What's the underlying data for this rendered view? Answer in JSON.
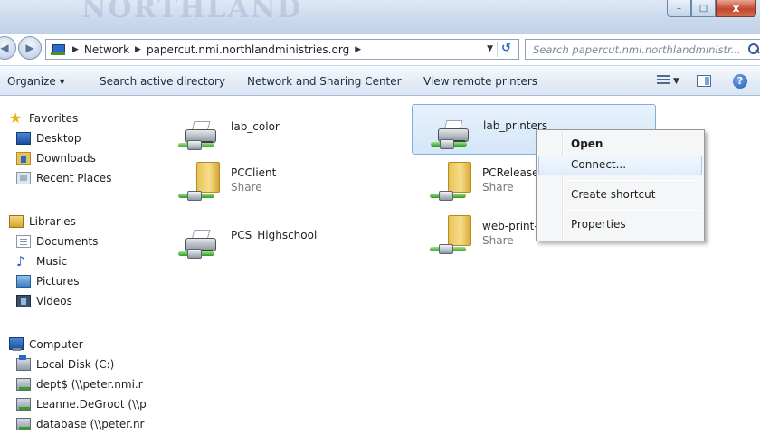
{
  "window": {
    "logo_text": "NORTHLAND",
    "minimize_label": "–",
    "maximize_label": "□",
    "close_label": "x"
  },
  "address_bar": {
    "breadcrumbs": [
      "Network",
      "papercut.nmi.northlandministries.org"
    ],
    "search_placeholder": "Search papercut.nmi.northlandministr..."
  },
  "command_bar": {
    "organize": "Organize ▾",
    "search_ad": "Search active directory",
    "network_sharing": "Network and Sharing Center",
    "view_printers": "View remote printers"
  },
  "nav_pane": {
    "favorites": {
      "label": "Favorites",
      "items": [
        "Desktop",
        "Downloads",
        "Recent Places"
      ]
    },
    "libraries": {
      "label": "Libraries",
      "items": [
        "Documents",
        "Music",
        "Pictures",
        "Videos"
      ]
    },
    "computer": {
      "label": "Computer",
      "items": [
        "Local Disk (C:)",
        "dept$ (\\\\peter.nmi.r",
        "Leanne.DeGroot (\\\\p",
        "database (\\\\peter.nr"
      ]
    }
  },
  "items": [
    {
      "name": "lab_color",
      "kind": "printer",
      "sub": ""
    },
    {
      "name": "lab_printers",
      "kind": "printer",
      "sub": "",
      "selected": true
    },
    {
      "name": "PCClient",
      "kind": "share",
      "sub": "Share"
    },
    {
      "name": "PCRelease",
      "kind": "share",
      "sub": "Share"
    },
    {
      "name": "PCS_Highschool",
      "kind": "printer",
      "sub": ""
    },
    {
      "name": "web-print-hc",
      "kind": "share",
      "sub": "Share"
    }
  ],
  "context_menu": {
    "open": "Open",
    "connect": "Connect...",
    "create_shortcut": "Create shortcut",
    "properties": "Properties"
  }
}
